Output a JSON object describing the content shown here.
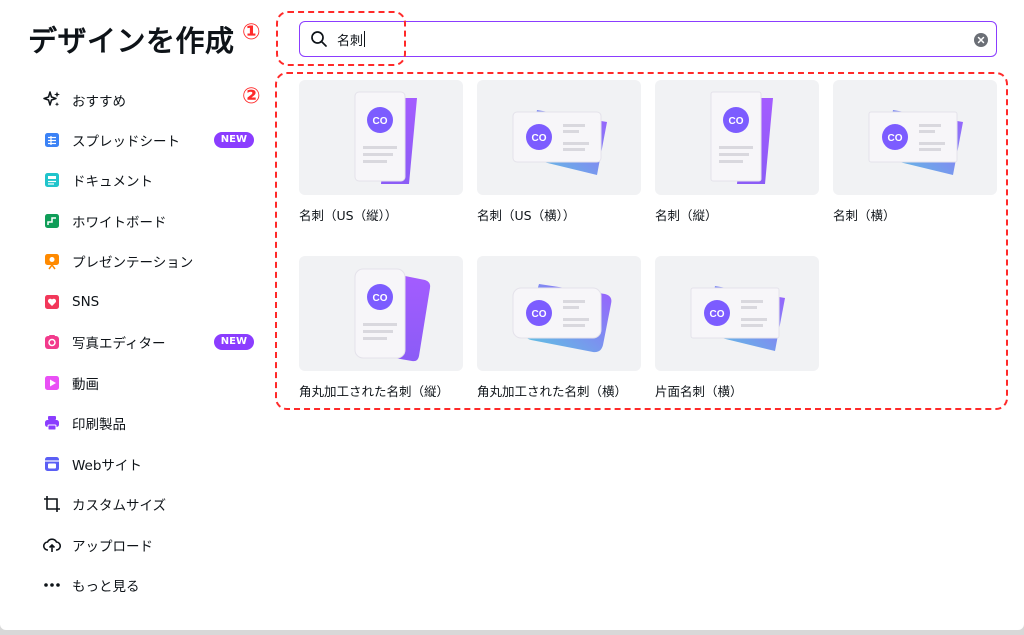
{
  "sidebar": {
    "title": "デザインを作成",
    "items": [
      {
        "label": "おすすめ",
        "icon": "sparkles-icon"
      },
      {
        "label": "スプレッドシート",
        "icon": "spreadsheet-icon",
        "badge": "NEW"
      },
      {
        "label": "ドキュメント",
        "icon": "document-icon"
      },
      {
        "label": "ホワイトボード",
        "icon": "whiteboard-icon"
      },
      {
        "label": "プレゼンテーション",
        "icon": "presentation-icon"
      },
      {
        "label": "SNS",
        "icon": "heart-icon"
      },
      {
        "label": "写真エディター",
        "icon": "camera-icon",
        "badge": "NEW"
      },
      {
        "label": "動画",
        "icon": "video-icon"
      },
      {
        "label": "印刷製品",
        "icon": "printer-icon"
      },
      {
        "label": "Webサイト",
        "icon": "website-icon"
      },
      {
        "label": "カスタムサイズ",
        "icon": "custom-size-icon"
      },
      {
        "label": "アップロード",
        "icon": "upload-icon"
      },
      {
        "label": "もっと見る",
        "icon": "more-icon"
      }
    ]
  },
  "search": {
    "value": "名刺"
  },
  "results": [
    {
      "label": "名刺（US（縦））",
      "orientation": "portrait",
      "logo": "CO"
    },
    {
      "label": "名刺（US（横））",
      "orientation": "landscape",
      "logo": "CO"
    },
    {
      "label": "名刺（縦）",
      "orientation": "portrait",
      "logo": "CO"
    },
    {
      "label": "名刺（横）",
      "orientation": "landscape",
      "logo": "CO"
    },
    {
      "label": "角丸加工された名刺（縦）",
      "orientation": "portrait",
      "logo": "CO"
    },
    {
      "label": "角丸加工された名刺（横）",
      "orientation": "landscape",
      "logo": "CO"
    },
    {
      "label": "片面名刺（横）",
      "orientation": "landscape",
      "logo": "CO"
    }
  ],
  "annotations": {
    "one": "①",
    "two": "②"
  },
  "colors": {
    "accent": "#8b3dff",
    "annotation": "#ff2a2a",
    "thumb_bg": "#f1f2f4"
  }
}
